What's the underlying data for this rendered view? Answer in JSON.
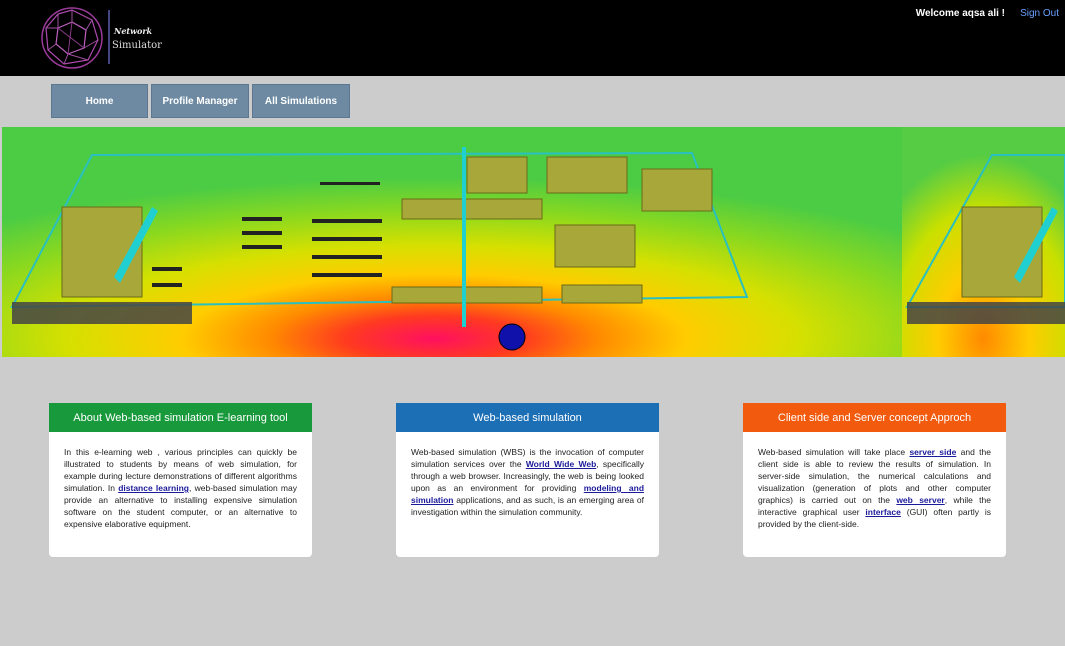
{
  "header": {
    "logo_line1": "Network",
    "logo_line2": "Simulator",
    "welcome": "Welcome aqsa ali !",
    "signout": "Sign Out"
  },
  "nav": {
    "home": "Home",
    "profile": "Profile Manager",
    "simulations": "All Simulations"
  },
  "cards": [
    {
      "title": "About Web-based simulation E-learning tool",
      "color": "#189a3c",
      "p1": "In this e-learning web , various principles can quickly be illustrated to students by means of web simulation, for example during lecture demonstrations of different algorithms simulation. In ",
      "link1": "distance learning",
      "p2": ", web-based simulation may provide an alternative to installing expensive simulation software on the student computer, or an alternative to expensive elaborative equipment."
    },
    {
      "title": "Web-based simulation",
      "color": "#1c6fb5",
      "p1": "Web-based simulation (WBS) is the invocation of computer simulation services over the ",
      "link1": "World Wide Web",
      "p2": ", specifically through a web browser. Increasingly, the web is being looked upon as an environment for providing ",
      "link2": "modeling and simulation",
      "p3": " applications, and as such, is an emerging area of investigation within the simulation community."
    },
    {
      "title": "Client side and Server concept Approch",
      "color": "#f25a0d",
      "p1": "Web-based simulation will take place ",
      "link1": "server side",
      "p2": " and the client side is able to review the results of simulation. In server-side simulation, the numerical calculations and visualization (generation of plots and other computer graphics) is carried out on the ",
      "link2": "web server",
      "p3": ", while the interactive graphical user ",
      "link3": "interface",
      "p4": " (GUI) often partly is provided by the client-side."
    }
  ]
}
